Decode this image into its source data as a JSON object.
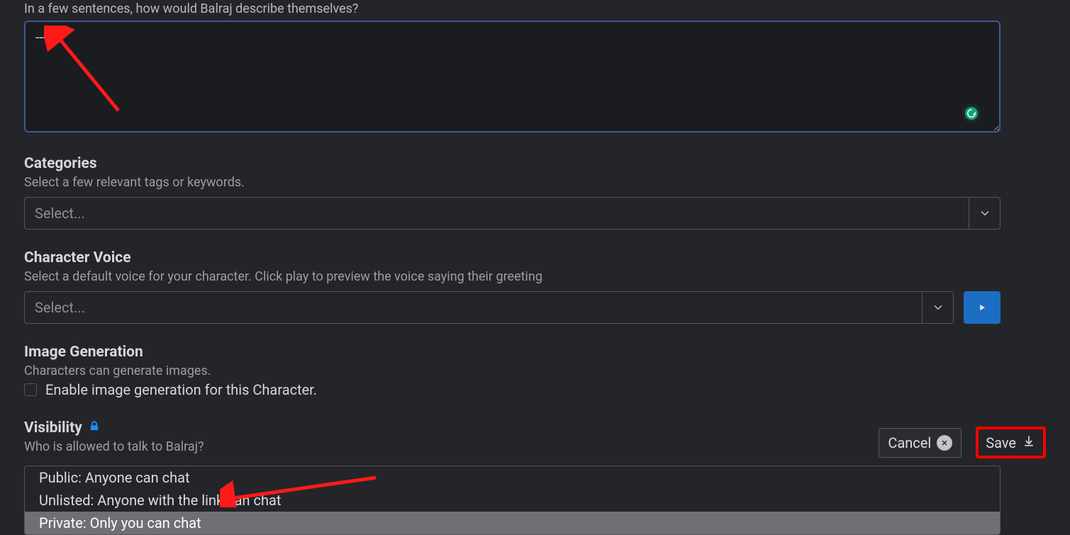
{
  "description": {
    "label": "In a few sentences, how would Balraj describe themselves?",
    "value": "----"
  },
  "categories": {
    "title": "Categories",
    "sub": "Select a few relevant tags or keywords.",
    "placeholder": "Select..."
  },
  "voice": {
    "title": "Character Voice",
    "sub": "Select a default voice for your character. Click play to preview the voice saying their greeting",
    "placeholder": "Select..."
  },
  "image_gen": {
    "title": "Image Generation",
    "sub": "Characters can generate images.",
    "checkbox_label": "Enable image generation for this Character."
  },
  "visibility": {
    "title": "Visibility",
    "sub": "Who is allowed to talk to Balraj?",
    "options": [
      "Public: Anyone can chat",
      "Unlisted: Anyone with the link can chat",
      "Private: Only you can chat"
    ]
  },
  "buttons": {
    "cancel": "Cancel",
    "save": "Save"
  }
}
